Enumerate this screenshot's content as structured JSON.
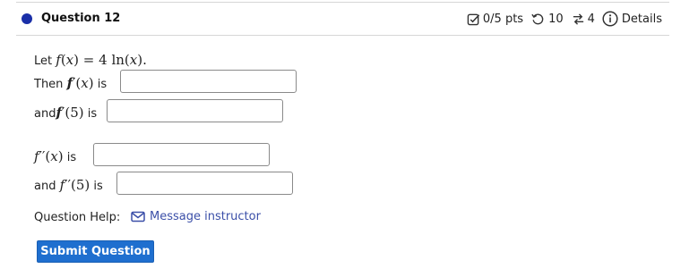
{
  "header": {
    "question_title": "Question 12",
    "points": "0/5 pts",
    "retries": "10",
    "versions": "4",
    "details": "Details"
  },
  "problem": {
    "let": "Let",
    "then": "Then",
    "and": "and",
    "is": "is",
    "f_label": "f",
    "x_var": "x",
    "coef": "4",
    "ln": "ln",
    "eval_point": "5",
    "prime": "′",
    "double_prime": "′′"
  },
  "answers": {
    "f_prime_x": "",
    "f_prime_5": "",
    "f_double_prime_x": "",
    "f_double_prime_5": ""
  },
  "help": {
    "label": "Question Help:",
    "message_link": "Message instructor"
  },
  "submit_label": "Submit Question",
  "colors": {
    "accent": "#1a2fa8",
    "button": "#1f6fcf",
    "link": "#3b4fa8"
  }
}
